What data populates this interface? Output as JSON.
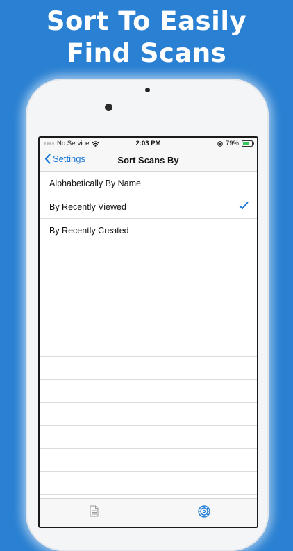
{
  "headline": {
    "line1": "Sort To Easily",
    "line2": "Find Scans"
  },
  "status_bar": {
    "carrier": "No Service",
    "time": "2:03 PM",
    "battery": "79%"
  },
  "nav": {
    "back_label": "Settings",
    "title": "Sort Scans By"
  },
  "options": [
    {
      "label": "Alphabetically By Name",
      "selected": false
    },
    {
      "label": "By Recently Viewed",
      "selected": true
    },
    {
      "label": "By Recently Created",
      "selected": false
    }
  ],
  "colors": {
    "background": "#2a80d2",
    "accent": "#1877d6"
  },
  "tabs": [
    {
      "icon": "document-icon",
      "active": false
    },
    {
      "icon": "gear-icon",
      "active": true
    }
  ]
}
